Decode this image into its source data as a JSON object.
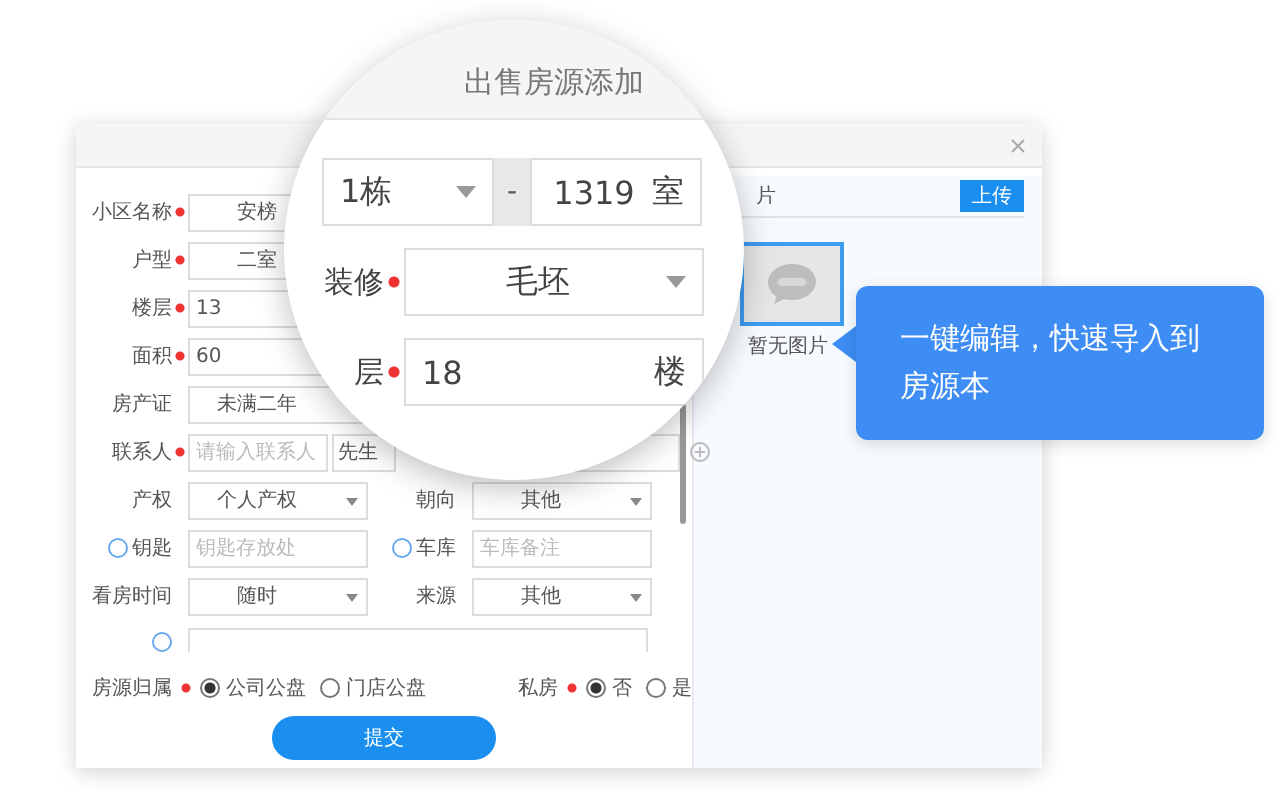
{
  "dialog": {
    "form": {
      "rows": [
        [
          {
            "kind": "input",
            "label": "小区名称",
            "required": true,
            "value": "安榜"
          }
        ],
        [
          {
            "kind": "input",
            "label": "户型",
            "required": true,
            "value": "二室"
          }
        ],
        [
          {
            "kind": "number",
            "label": "楼层",
            "required": true,
            "value": "13"
          }
        ],
        [
          {
            "kind": "number",
            "label": "面积",
            "required": true,
            "value": "60"
          }
        ],
        [
          {
            "kind": "input",
            "label": "房产证",
            "value": "未满二年"
          }
        ],
        [
          {
            "kind": "contact",
            "label": "联系人",
            "required": true,
            "placeholder": "请输入联系人",
            "option": "先生"
          },
          {
            "kind": "add"
          }
        ],
        [
          {
            "kind": "select",
            "label": "产权",
            "value": "个人产权"
          },
          {
            "kind": "select",
            "label": "朝向",
            "value": "其他"
          }
        ],
        [
          {
            "kind": "radio-input",
            "label": "钥匙",
            "checked": false,
            "placeholder": "钥匙存放处"
          },
          {
            "kind": "radio-input",
            "label": "车库",
            "checked": false,
            "placeholder": "车库备注"
          }
        ],
        [
          {
            "kind": "select",
            "label": "看房时间",
            "value": "随时"
          },
          {
            "kind": "select",
            "label": "来源",
            "value": "其他"
          }
        ],
        [
          {
            "kind": "partial",
            "checked": false
          }
        ]
      ],
      "radio_groups": [
        {
          "label": "房源归属",
          "required": true,
          "options": [
            {
              "label": "公司公盘",
              "selected": true
            },
            {
              "label": "门店公盘",
              "selected": false
            }
          ]
        },
        {
          "label": "私房",
          "required": true,
          "options": [
            {
              "label": "否",
              "selected": true
            },
            {
              "label": "是",
              "selected": false
            }
          ]
        }
      ],
      "submit": "提交"
    },
    "photos": {
      "heading": "片",
      "upload": "上传",
      "caption": "暂无图片"
    }
  },
  "magnifier": {
    "title": "出售房源添加",
    "building": "1栋",
    "separator": "-",
    "room": "1319",
    "room_suffix": "室",
    "decoration": {
      "label": "装修",
      "required": true,
      "value": "毛坯"
    },
    "floor": {
      "label": "层",
      "required": true,
      "value": "18",
      "suffix": "楼"
    }
  },
  "callout": "一键编辑，快速导入到房源本"
}
